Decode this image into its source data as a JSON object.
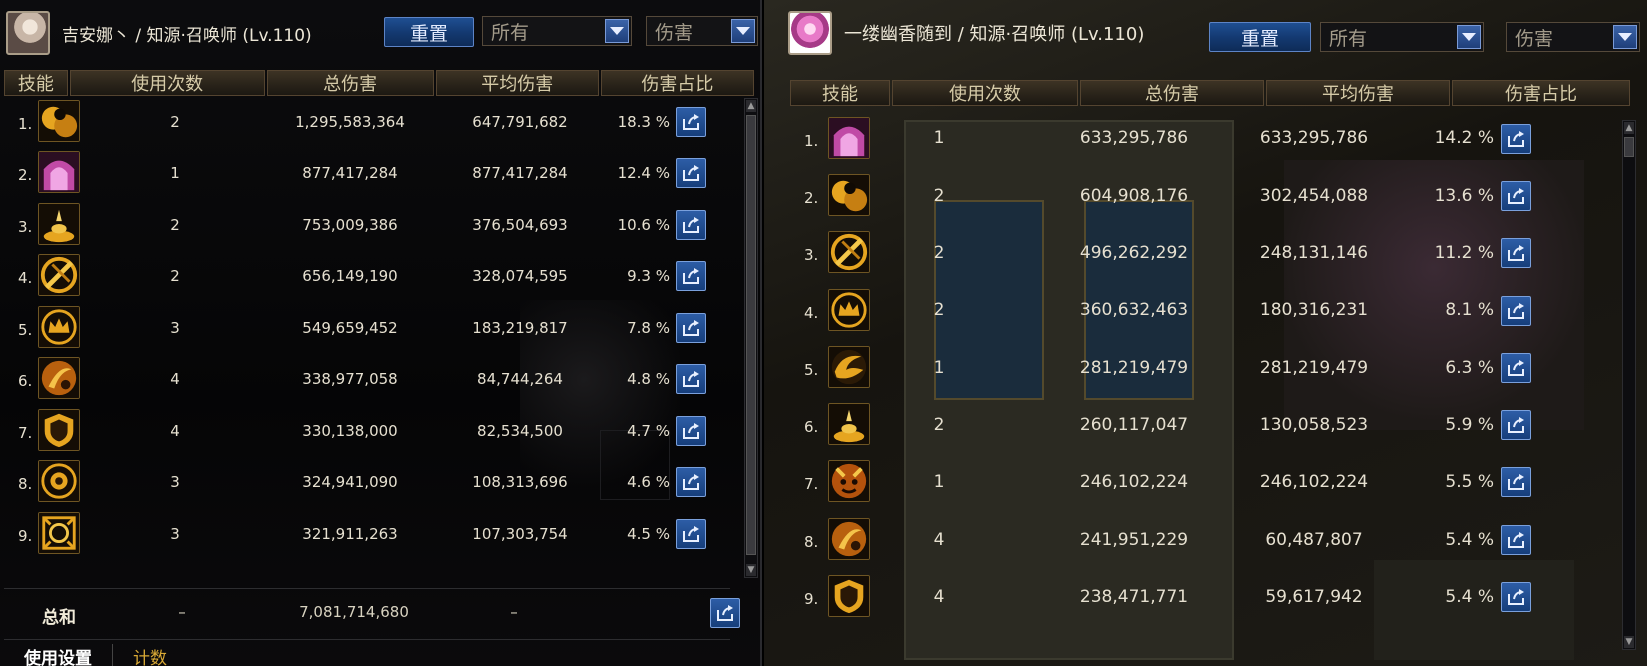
{
  "left": {
    "character": "吉安娜丶 / 知源·召唤师 (Lv.110)",
    "reset_label": "重置",
    "filter_all": "所有",
    "filter_damage": "伤害",
    "columns": [
      "技能",
      "使用次数",
      "总伤害",
      "平均伤害",
      "伤害占比"
    ],
    "rows": [
      {
        "rank": "1.",
        "icon": "twin-orb-icon",
        "uses": "2",
        "total": "1,295,583,364",
        "avg": "647,791,682",
        "pct": "18.3 %"
      },
      {
        "rank": "2.",
        "icon": "pink-gate-icon",
        "uses": "1",
        "total": "877,417,284",
        "avg": "877,417,284",
        "pct": "12.4 %"
      },
      {
        "rank": "3.",
        "icon": "gold-pile-icon",
        "uses": "2",
        "total": "753,009,386",
        "avg": "376,504,693",
        "pct": "10.6 %"
      },
      {
        "rank": "4.",
        "icon": "slash-seal-icon",
        "uses": "2",
        "total": "656,149,190",
        "avg": "328,074,595",
        "pct": "9.3 %"
      },
      {
        "rank": "5.",
        "icon": "crown-icon",
        "uses": "3",
        "total": "549,659,452",
        "avg": "183,219,817",
        "pct": "7.8 %"
      },
      {
        "rank": "6.",
        "icon": "claw-icon",
        "uses": "4",
        "total": "338,977,058",
        "avg": "84,744,264",
        "pct": "4.8 %"
      },
      {
        "rank": "7.",
        "icon": "shield-icon",
        "uses": "4",
        "total": "330,138,000",
        "avg": "82,534,500",
        "pct": "4.7 %"
      },
      {
        "rank": "8.",
        "icon": "sun-medal-icon",
        "uses": "3",
        "total": "324,941,090",
        "avg": "108,313,696",
        "pct": "4.6 %"
      },
      {
        "rank": "9.",
        "icon": "rune-frame-icon",
        "uses": "3",
        "total": "321,911,263",
        "avg": "107,303,754",
        "pct": "4.5 %"
      }
    ],
    "total_label": "总和",
    "total_uses": "–",
    "total_damage": "7,081,714,680",
    "total_avg": "–",
    "tabs": [
      "使用设置",
      "计数"
    ]
  },
  "right": {
    "character": "一缕幽香随到 / 知源·召唤师 (Lv.110)",
    "reset_label": "重置",
    "filter_all": "所有",
    "filter_damage": "伤害",
    "columns": [
      "技能",
      "使用次数",
      "总伤害",
      "平均伤害",
      "伤害占比"
    ],
    "rows": [
      {
        "rank": "1.",
        "icon": "pink-gate-icon",
        "uses": "1",
        "total": "633,295,786",
        "avg": "633,295,786",
        "pct": "14.2 %"
      },
      {
        "rank": "2.",
        "icon": "twin-orb-icon",
        "uses": "2",
        "total": "604,908,176",
        "avg": "302,454,088",
        "pct": "13.6 %"
      },
      {
        "rank": "3.",
        "icon": "slash-seal-icon",
        "uses": "2",
        "total": "496,262,292",
        "avg": "248,131,146",
        "pct": "11.2 %"
      },
      {
        "rank": "4.",
        "icon": "crown-icon",
        "uses": "2",
        "total": "360,632,463",
        "avg": "180,316,231",
        "pct": "8.1 %"
      },
      {
        "rank": "5.",
        "icon": "swirl-icon",
        "uses": "1",
        "total": "281,219,479",
        "avg": "281,219,479",
        "pct": "6.3 %"
      },
      {
        "rank": "6.",
        "icon": "gold-pile-icon",
        "uses": "2",
        "total": "260,117,047",
        "avg": "130,058,523",
        "pct": "5.9 %"
      },
      {
        "rank": "7.",
        "icon": "demon-face-icon",
        "uses": "1",
        "total": "246,102,224",
        "avg": "246,102,224",
        "pct": "5.5 %"
      },
      {
        "rank": "8.",
        "icon": "claw-icon",
        "uses": "4",
        "total": "241,951,229",
        "avg": "60,487,807",
        "pct": "5.4 %"
      },
      {
        "rank": "9.",
        "icon": "shield-icon",
        "uses": "4",
        "total": "238,471,771",
        "avg": "59,617,942",
        "pct": "5.4 %"
      }
    ]
  },
  "colors": {
    "gold": "#e6a520",
    "accent_blue": "#1f4f92",
    "header_brown": "#2a241a"
  }
}
